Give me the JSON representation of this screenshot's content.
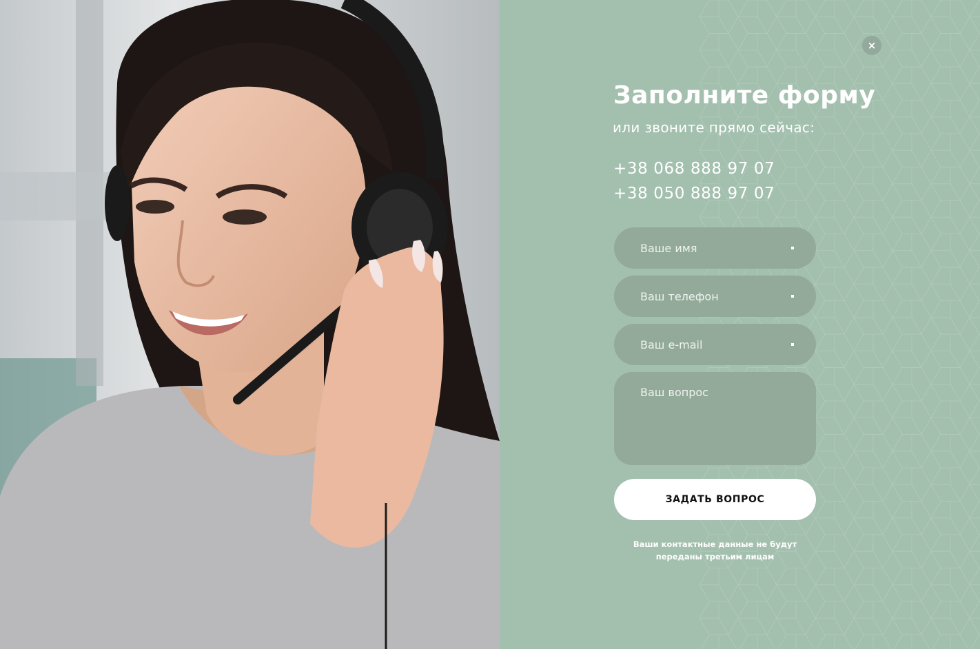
{
  "photo": {
    "alt": "Смеющаяся девушка-оператор в гарнитуре"
  },
  "form": {
    "close_icon": "close-icon",
    "close_glyph": "×",
    "title": "Заполните форму",
    "subtitle": "или звоните прямо сейчас:",
    "phones": [
      "+38 068 888 97 07",
      "+38 050 888 97 07"
    ],
    "fields": {
      "name_placeholder": "Ваше имя",
      "phone_placeholder": "Ваш телефон",
      "email_placeholder": "Ваш e-mail",
      "question_placeholder": "Ваш вопрос"
    },
    "submit_label": "ЗАДАТЬ ВОПРОС",
    "privacy_note_line1": "Ваши контактные данные не будут",
    "privacy_note_line2": "переданы третьим лицам"
  },
  "colors": {
    "panel_bg": "#a3bfae",
    "field_bg": "#93aa9a",
    "button_bg": "#ffffff",
    "text": "#ffffff"
  }
}
